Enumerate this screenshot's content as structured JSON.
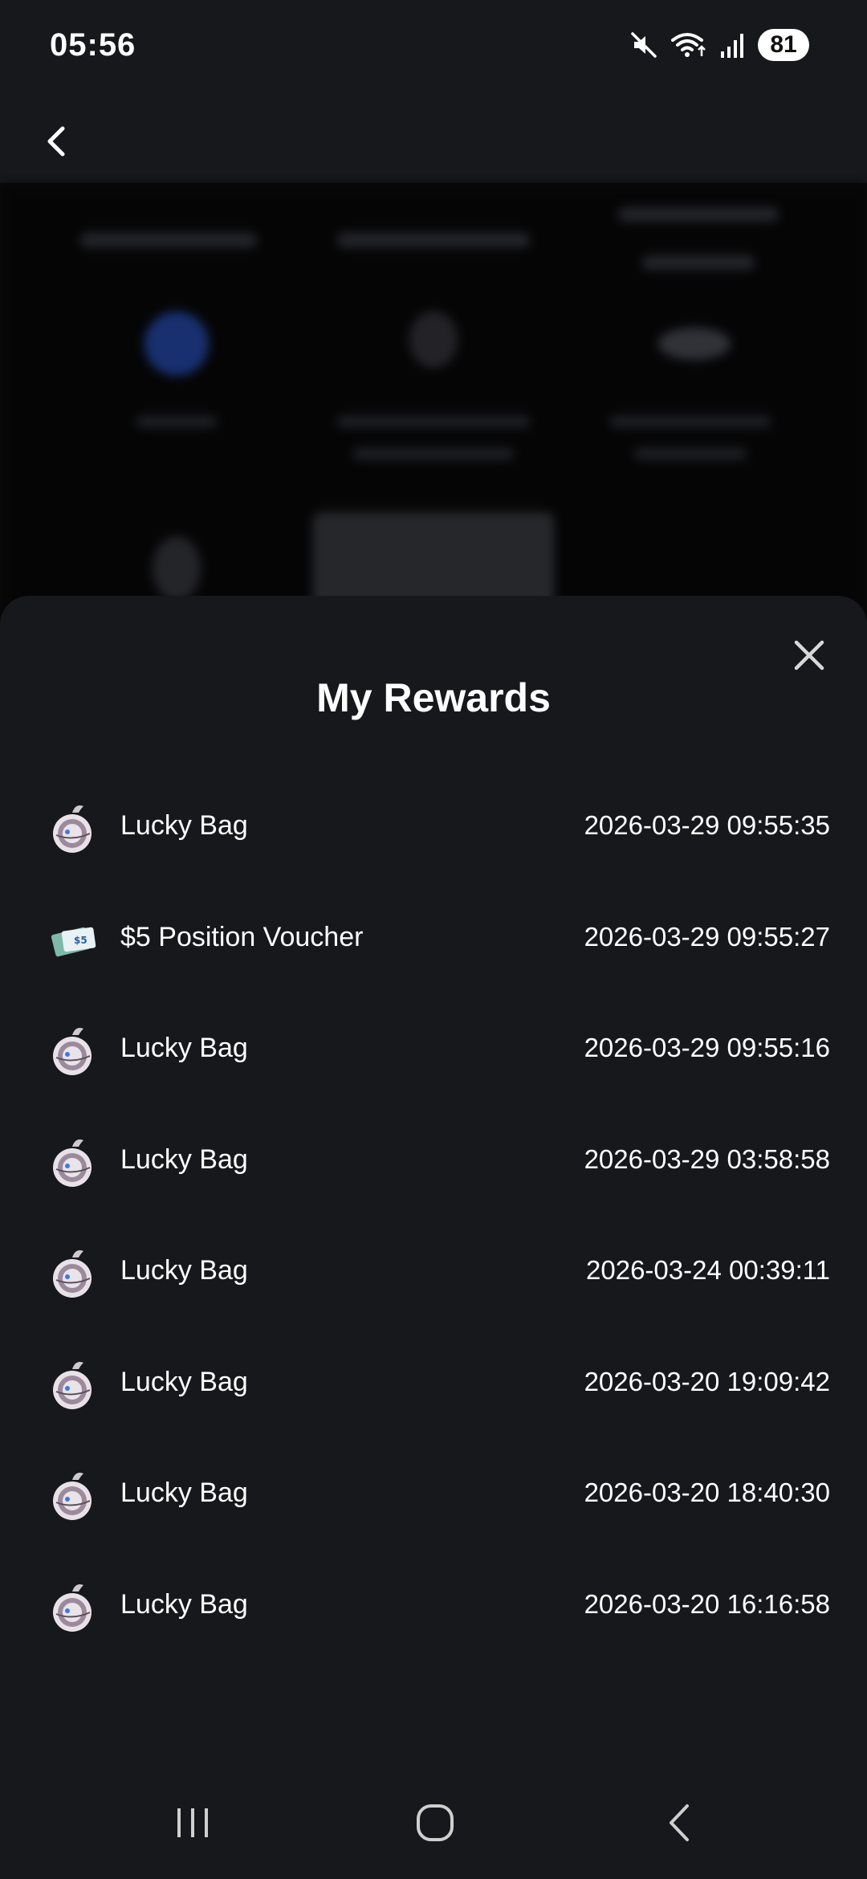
{
  "status_bar": {
    "time": "05:56",
    "battery": "81",
    "icons": [
      "mute-icon",
      "wifi-icon",
      "signal-icon",
      "battery-icon"
    ]
  },
  "top_nav": {
    "back_icon": "chevron-left-icon"
  },
  "sheet": {
    "title": "My Rewards",
    "close_icon": "close-icon",
    "rewards": [
      {
        "name": "Lucky Bag",
        "time": "2026-03-29 09:55:35",
        "icon": "lucky-bag-icon"
      },
      {
        "name": "$5 Position Voucher",
        "time": "2026-03-29 09:55:27",
        "icon": "voucher-icon"
      },
      {
        "name": "Lucky Bag",
        "time": "2026-03-29 09:55:16",
        "icon": "lucky-bag-icon"
      },
      {
        "name": "Lucky Bag",
        "time": "2026-03-29 03:58:58",
        "icon": "lucky-bag-icon"
      },
      {
        "name": "Lucky Bag",
        "time": "2026-03-24 00:39:11",
        "icon": "lucky-bag-icon"
      },
      {
        "name": "Lucky Bag",
        "time": "2026-03-20 19:09:42",
        "icon": "lucky-bag-icon"
      },
      {
        "name": "Lucky Bag",
        "time": "2026-03-20 18:40:30",
        "icon": "lucky-bag-icon"
      },
      {
        "name": "Lucky Bag",
        "time": "2026-03-20 16:16:58",
        "icon": "lucky-bag-icon"
      }
    ]
  },
  "nav_bar": {
    "icons": [
      "recent-apps-icon",
      "home-icon",
      "back-icon"
    ]
  },
  "colors": {
    "sheet_background": "#17181b",
    "text": "#ffffff",
    "backdrop": "#0a0a0b"
  }
}
